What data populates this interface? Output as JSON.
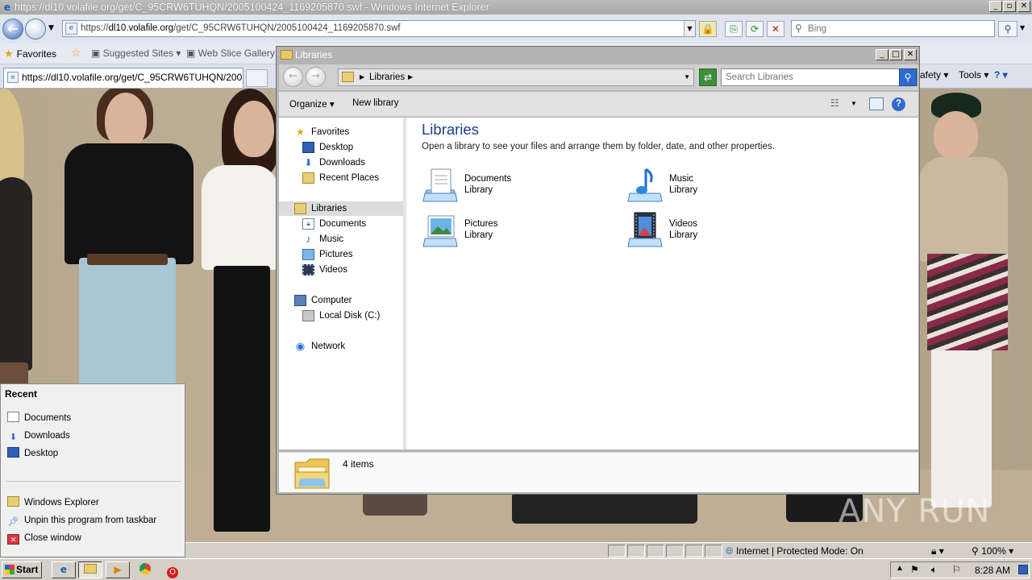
{
  "ie": {
    "title": "https://dl10.volafile.org/get/C_95CRW6TUHQN/2005100424_1169205870.swf - Windows Internet Explorer",
    "url_prefix": "https://",
    "url_host": "dl10.volafile.org",
    "url_path": "/get/C_95CRW6TUHQN/2005100424_1169205870.swf",
    "search_placeholder": "Bing",
    "favorites_label": "Favorites",
    "fav_links": [
      "Suggested Sites",
      "Web Slice Gallery"
    ],
    "tab_title": "https://dl10.volafile.org/get/C_95CRW6TUHQN/2005...",
    "commands": {
      "safety": "afety",
      "tools": "Tools"
    },
    "status": {
      "zone": "Internet | Protected Mode: On",
      "zoom": "100%"
    }
  },
  "explorer": {
    "title": "Libraries",
    "breadcrumb": "Libraries",
    "search_placeholder": "Search Libraries",
    "toolbar": {
      "organize": "Organize",
      "new_library": "New library"
    },
    "nav": {
      "favorites": "Favorites",
      "favorites_items": [
        "Desktop",
        "Downloads",
        "Recent Places"
      ],
      "libraries": "Libraries",
      "libraries_items": [
        "Documents",
        "Music",
        "Pictures",
        "Videos"
      ],
      "computer": "Computer",
      "computer_items": [
        "Local Disk (C:)"
      ],
      "network": "Network"
    },
    "heading": "Libraries",
    "description": "Open a library to see your files and arrange them by folder, date, and other properties.",
    "libraries": [
      {
        "name": "Documents",
        "sub": "Library",
        "icon": "documents-icon"
      },
      {
        "name": "Music",
        "sub": "Library",
        "icon": "music-icon"
      },
      {
        "name": "Pictures",
        "sub": "Library",
        "icon": "pictures-icon"
      },
      {
        "name": "Videos",
        "sub": "Library",
        "icon": "videos-icon"
      }
    ],
    "item_count": "4 items"
  },
  "jumplist": {
    "recent_header": "Recent",
    "recent": [
      "Documents",
      "Downloads",
      "Desktop"
    ],
    "tasks": [
      "Windows Explorer",
      "Unpin this program from taskbar",
      "Close window"
    ]
  },
  "taskbar": {
    "start": "Start",
    "clock": "8:28 AM"
  },
  "watermark": "ANY RUN",
  "colors": {
    "heading": "#1a3e8c",
    "selection": "#dcdcdc",
    "accent": "#2e6bd1"
  }
}
